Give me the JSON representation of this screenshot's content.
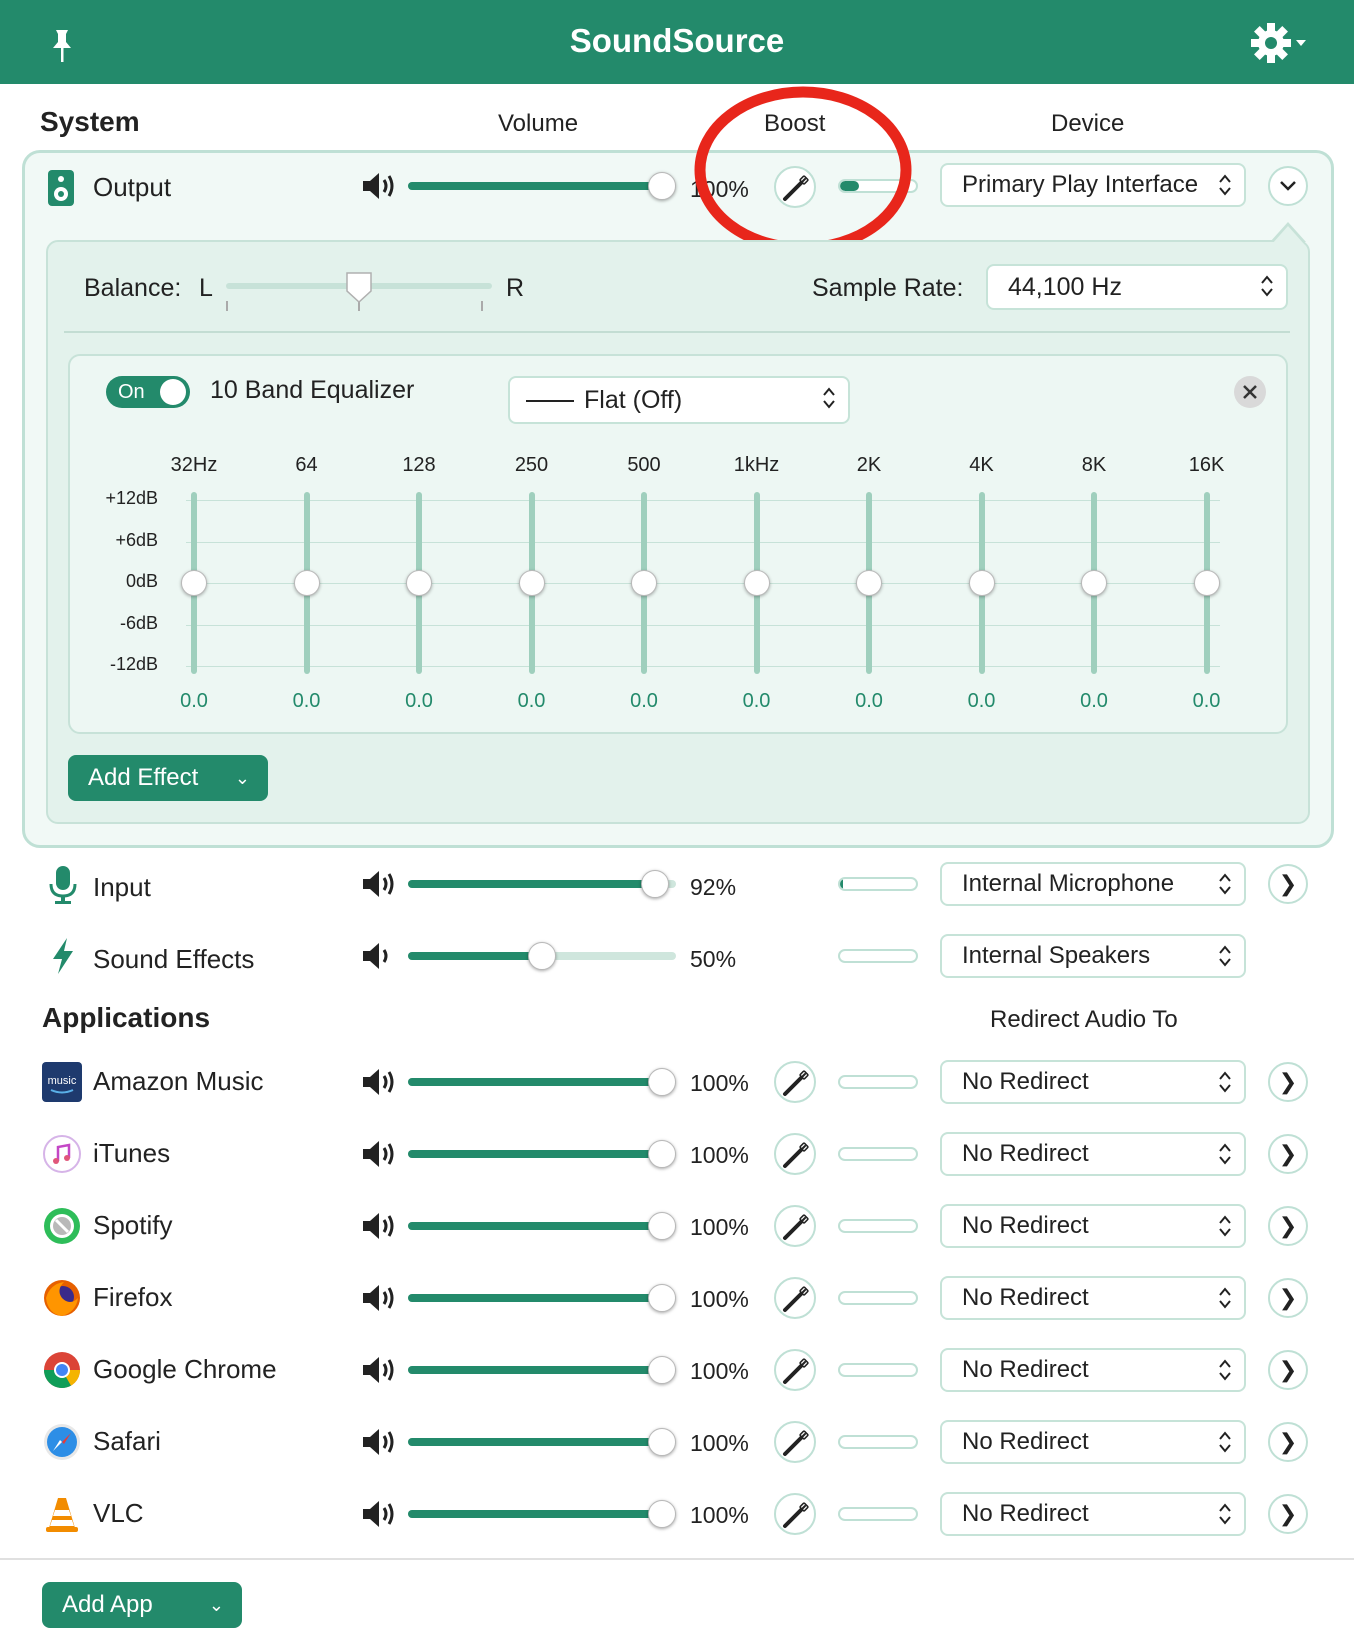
{
  "window": {
    "title": "SoundSource",
    "pin_icon": "pin-icon",
    "settings_icon": "gear-icon"
  },
  "colors": {
    "accent": "#238a6b",
    "panel": "#e3f2ec",
    "highlight": "#e8261b"
  },
  "system": {
    "heading": "System",
    "col_volume": "Volume",
    "col_boost": "Boost",
    "col_device": "Device",
    "output": {
      "label": "Output",
      "icon": "speaker-device-icon",
      "volume": 1.0,
      "volume_text": "100%",
      "boost_level": 0.25,
      "device": "Primary Play Interface",
      "balance_label": "Balance:",
      "balance_left": "L",
      "balance_right": "R",
      "balance_value": 0.5,
      "sample_rate_label": "Sample Rate:",
      "sample_rate": "44,100 Hz"
    },
    "input": {
      "label": "Input",
      "icon": "microphone-icon",
      "volume": 0.92,
      "volume_text": "92%",
      "boost_level": 0.02,
      "device": "Internal Microphone"
    },
    "sound_effects": {
      "label": "Sound Effects",
      "icon": "lightning-icon",
      "volume": 0.5,
      "volume_text": "50%",
      "boost_level": 0.0,
      "device": "Internal Speakers"
    }
  },
  "equalizer": {
    "toggle": "On",
    "title": "10 Band Equalizer",
    "preset": "Flat (Off)",
    "bands": [
      "32Hz",
      "64",
      "128",
      "250",
      "500",
      "1kHz",
      "2K",
      "4K",
      "8K",
      "16K"
    ],
    "values": [
      0.0,
      0.0,
      0.0,
      0.0,
      0.0,
      0.0,
      0.0,
      0.0,
      0.0,
      0.0
    ],
    "value_labels": [
      "0.0",
      "0.0",
      "0.0",
      "0.0",
      "0.0",
      "0.0",
      "0.0",
      "0.0",
      "0.0",
      "0.0"
    ],
    "db_labels": [
      "+12dB",
      "+6dB",
      "0dB",
      "-6dB",
      "-12dB"
    ],
    "range": [
      -12,
      12
    ]
  },
  "add_effect": "Add Effect",
  "applications": {
    "heading": "Applications",
    "col_redirect": "Redirect Audio To",
    "items": [
      {
        "name": "Amazon Music",
        "icon": "amazon-music-icon",
        "volume": 1.0,
        "volume_text": "100%",
        "boost_level": 0.0,
        "redirect": "No Redirect"
      },
      {
        "name": "iTunes",
        "icon": "itunes-icon",
        "volume": 1.0,
        "volume_text": "100%",
        "boost_level": 0.0,
        "redirect": "No Redirect"
      },
      {
        "name": "Spotify",
        "icon": "spotify-icon",
        "volume": 1.0,
        "volume_text": "100%",
        "boost_level": 0.0,
        "redirect": "No Redirect"
      },
      {
        "name": "Firefox",
        "icon": "firefox-icon",
        "volume": 1.0,
        "volume_text": "100%",
        "boost_level": 0.0,
        "redirect": "No Redirect"
      },
      {
        "name": "Google Chrome",
        "icon": "chrome-icon",
        "volume": 1.0,
        "volume_text": "100%",
        "boost_level": 0.0,
        "redirect": "No Redirect"
      },
      {
        "name": "Safari",
        "icon": "safari-icon",
        "volume": 1.0,
        "volume_text": "100%",
        "boost_level": 0.0,
        "redirect": "No Redirect"
      },
      {
        "name": "VLC",
        "icon": "vlc-icon",
        "volume": 1.0,
        "volume_text": "100%",
        "boost_level": 0.0,
        "redirect": "No Redirect"
      }
    ]
  },
  "amazon_icon_text": "music",
  "add_app": "Add App"
}
